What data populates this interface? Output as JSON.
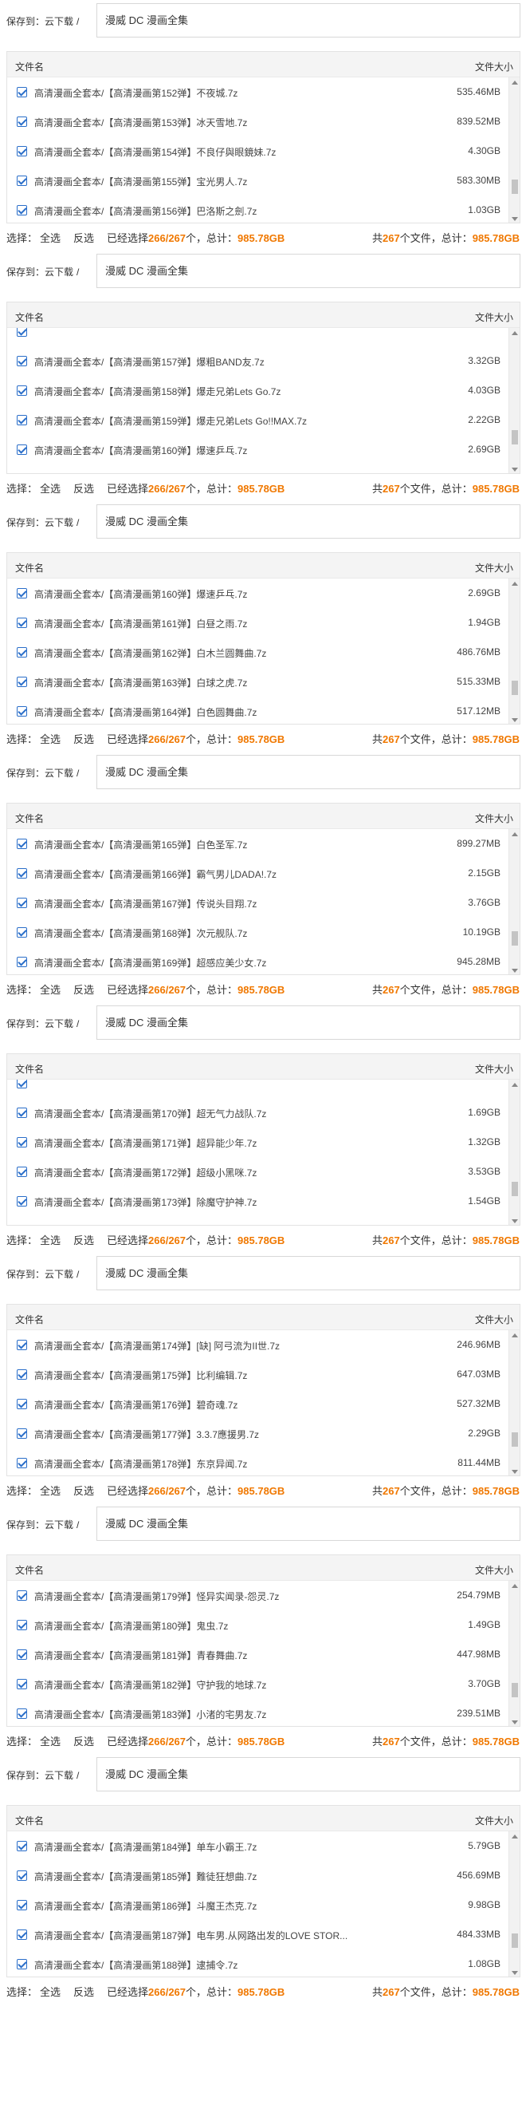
{
  "labels": {
    "save_to": "保存到：",
    "cloud": "云下载",
    "sep": "/",
    "path": "漫威 DC 漫画全集",
    "col_name": "文件名",
    "col_size": "文件大小",
    "select_label": "选择：",
    "select_all": "全选",
    "invert": "反选",
    "selected_prefix": "已经选择",
    "selected_count": "266/267",
    "selected_mid": "个，总计：",
    "selected_total": "985.78GB",
    "all_prefix": "共",
    "all_count": "267",
    "all_mid": "个文件，总计：",
    "all_total": "985.78GB"
  },
  "panels": [
    {
      "partial_top": false,
      "partial_bottom": false,
      "rows": [
        {
          "name": "高清漫画全套本/【高清漫画第152弹】不夜城.7z",
          "size": "535.46MB"
        },
        {
          "name": "高清漫画全套本/【高清漫画第153弹】冰天雪地.7z",
          "size": "839.52MB"
        },
        {
          "name": "高清漫画全套本/【高清漫画第154弹】不良仔與眼鏡妹.7z",
          "size": "4.30GB"
        },
        {
          "name": "高清漫画全套本/【高清漫画第155弹】宝光男人.7z",
          "size": "583.30MB"
        },
        {
          "name": "高清漫画全套本/【高清漫画第156弹】巴洛斯之劍.7z",
          "size": "1.03GB"
        }
      ]
    },
    {
      "partial_top": true,
      "partial_bottom": true,
      "rows": [
        {
          "name": "",
          "size": ""
        },
        {
          "name": "高清漫画全套本/【高清漫画第157弹】爆粗BAND友.7z",
          "size": "3.32GB"
        },
        {
          "name": "高清漫画全套本/【高清漫画第158弹】爆走兄弟Lets Go.7z",
          "size": "4.03GB"
        },
        {
          "name": "高清漫画全套本/【高清漫画第159弹】爆走兄弟Lets Go!!MAX.7z",
          "size": "2.22GB"
        },
        {
          "name": "高清漫画全套本/【高清漫画第160弹】爆速乒乓.7z",
          "size": "2.69GB"
        },
        {
          "name": "高清漫画全套本/【高清漫画第161弹】白昼之雨.7z",
          "size": "1.94GB"
        }
      ]
    },
    {
      "partial_top": false,
      "partial_bottom": false,
      "rows": [
        {
          "name": "高清漫画全套本/【高清漫画第160弹】爆速乒乓.7z",
          "size": "2.69GB"
        },
        {
          "name": "高清漫画全套本/【高清漫画第161弹】白昼之雨.7z",
          "size": "1.94GB"
        },
        {
          "name": "高清漫画全套本/【高清漫画第162弹】白木兰圆舞曲.7z",
          "size": "486.76MB"
        },
        {
          "name": "高清漫画全套本/【高清漫画第163弹】白球之虎.7z",
          "size": "515.33MB"
        },
        {
          "name": "高清漫画全套本/【高清漫画第164弹】白色圆舞曲.7z",
          "size": "517.12MB"
        }
      ]
    },
    {
      "partial_top": false,
      "partial_bottom": false,
      "rows": [
        {
          "name": "高清漫画全套本/【高清漫画第165弹】白色圣军.7z",
          "size": "899.27MB"
        },
        {
          "name": "高清漫画全套本/【高清漫画第166弹】霸气男儿DADA!.7z",
          "size": "2.15GB"
        },
        {
          "name": "高清漫画全套本/【高清漫画第167弹】传说头目翔.7z",
          "size": "3.76GB"
        },
        {
          "name": "高清漫画全套本/【高清漫画第168弹】次元舰队.7z",
          "size": "10.19GB"
        },
        {
          "name": "高清漫画全套本/【高清漫画第169弹】超感应美少女.7z",
          "size": "945.28MB"
        }
      ]
    },
    {
      "partial_top": true,
      "partial_bottom": true,
      "rows": [
        {
          "name": "",
          "size": ""
        },
        {
          "name": "高清漫画全套本/【高清漫画第170弹】超无气力战队.7z",
          "size": "1.69GB"
        },
        {
          "name": "高清漫画全套本/【高清漫画第171弹】超异能少年.7z",
          "size": "1.32GB"
        },
        {
          "name": "高清漫画全套本/【高清漫画第172弹】超级小黑咪.7z",
          "size": "3.53GB"
        },
        {
          "name": "高清漫画全套本/【高清漫画第173弹】除魔守护神.7z",
          "size": "1.54GB"
        },
        {
          "name": "高清漫画全套本/【高清漫画第174弹】[缺] 阿弓流为II世.7z",
          "size": "246.96MB"
        }
      ]
    },
    {
      "partial_top": false,
      "partial_bottom": false,
      "rows": [
        {
          "name": "高清漫画全套本/【高清漫画第174弹】[缺] 阿弓流为II世.7z",
          "size": "246.96MB"
        },
        {
          "name": "高清漫画全套本/【高清漫画第175弹】比利编辑.7z",
          "size": "647.03MB"
        },
        {
          "name": "高清漫画全套本/【高清漫画第176弹】碧奇魂.7z",
          "size": "527.32MB"
        },
        {
          "name": "高清漫画全套本/【高清漫画第177弹】3.3.7應援男.7z",
          "size": "2.29GB"
        },
        {
          "name": "高清漫画全套本/【高清漫画第178弹】东京异闻.7z",
          "size": "811.44MB"
        }
      ]
    },
    {
      "partial_top": false,
      "partial_bottom": false,
      "rows": [
        {
          "name": "高清漫画全套本/【高清漫画第179弹】怪异实闻录-怨灵.7z",
          "size": "254.79MB"
        },
        {
          "name": "高清漫画全套本/【高清漫画第180弹】鬼虫.7z",
          "size": "1.49GB"
        },
        {
          "name": "高清漫画全套本/【高清漫画第181弹】青春舞曲.7z",
          "size": "447.98MB"
        },
        {
          "name": "高清漫画全套本/【高清漫画第182弹】守护我的地球.7z",
          "size": "3.70GB"
        },
        {
          "name": "高清漫画全套本/【高清漫画第183弹】小渚的宅男友.7z",
          "size": "239.51MB"
        }
      ]
    },
    {
      "partial_top": false,
      "partial_bottom": true,
      "rows": [
        {
          "name": "高清漫画全套本/【高清漫画第184弹】单车小霸王.7z",
          "size": "5.79GB"
        },
        {
          "name": "高清漫画全套本/【高清漫画第185弹】難徒狂想曲.7z",
          "size": "456.69MB"
        },
        {
          "name": "高清漫画全套本/【高清漫画第186弹】斗魔王杰克.7z",
          "size": "9.98GB"
        },
        {
          "name": "高清漫画全套本/【高清漫画第187弹】电车男.从网路出发的LOVE STOR...",
          "size": "484.33MB"
        },
        {
          "name": "高清漫画全套本/【高清漫画第188弹】逮捕令.7z",
          "size": "1.08GB"
        }
      ]
    }
  ]
}
